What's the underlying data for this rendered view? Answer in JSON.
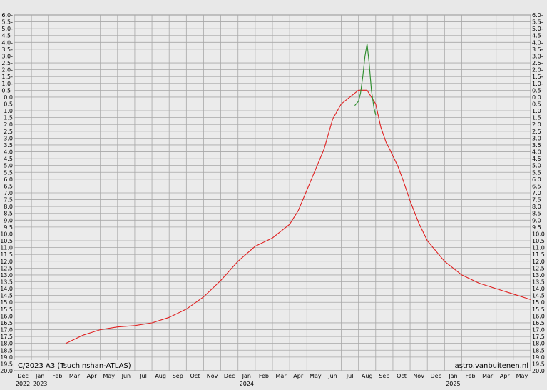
{
  "chart_data": {
    "type": "line",
    "title": "C/2023 A3 (Tsuchinshan-ATLAS)",
    "credit": "astro.vanbuitenen.nl",
    "y_tick_labels": [
      "6.0-",
      "5.5-",
      "5.0-",
      "4.5-",
      "4.0-",
      "3.5-",
      "3.0-",
      "2.5-",
      "2.0-",
      "1.5-",
      "1.0-",
      "0.5-",
      "0.0",
      "0.5",
      "1.0",
      "1.5",
      "2.0",
      "2.5",
      "3.0",
      "3.5",
      "4.0",
      "4.5",
      "5.0",
      "5.5",
      "6.0",
      "6.5",
      "7.0",
      "7.5",
      "8.0",
      "8.5",
      "9.0",
      "9.5",
      "10.0",
      "10.5",
      "11.0",
      "11.5",
      "12.0",
      "12.5",
      "13.0",
      "13.5",
      "14.0",
      "14.5",
      "15.0",
      "15.5",
      "16.0",
      "16.5",
      "17.0",
      "17.5",
      "18.0",
      "18.5",
      "19.0",
      "19.5",
      "20.0"
    ],
    "yrange": [
      -6,
      20
    ],
    "y_inverted": true,
    "x_months": [
      "Dec",
      "Jan",
      "Feb",
      "Mar",
      "Apr",
      "May",
      "Jun",
      "Jul",
      "Aug",
      "Sep",
      "Oct",
      "Nov",
      "Dec",
      "Jan",
      "Feb",
      "Mar",
      "Apr",
      "May",
      "Jun",
      "Jul",
      "Aug",
      "Sep",
      "Oct",
      "Nov",
      "Dec",
      "Jan",
      "Feb",
      "Mar",
      "Apr",
      "May"
    ],
    "x_years": [
      {
        "label": "2022",
        "month_index": 0
      },
      {
        "label": "2023",
        "month_index": 1
      },
      {
        "label": "2024",
        "month_index": 13
      },
      {
        "label": "2025",
        "month_index": 25
      }
    ],
    "grid": true,
    "series": [
      {
        "color": "#e02020",
        "x": [
          3.0,
          3.5,
          4.0,
          4.5,
          5.0,
          6.0,
          7.0,
          8.0,
          9.0,
          10.0,
          11.0,
          12.0,
          13.0,
          14.0,
          15.0,
          16.0,
          16.5,
          17.0,
          18.0,
          18.5,
          19.0,
          19.5,
          20.0,
          20.5,
          21.0,
          21.3,
          21.6,
          21.85,
          22.0,
          22.15,
          22.3,
          22.45,
          22.6,
          23.0,
          23.5,
          24.0,
          25.0,
          26.0,
          27.0,
          28.0,
          29.0,
          30.0
        ],
        "y": [
          18.0,
          17.7,
          17.4,
          17.2,
          17.0,
          16.8,
          16.7,
          16.5,
          16.1,
          15.5,
          14.6,
          13.4,
          12.0,
          10.9,
          10.3,
          9.3,
          8.3,
          6.8,
          3.8,
          1.6,
          0.5,
          0.0,
          -0.5,
          -0.5,
          0.5,
          2.2,
          3.3,
          3.9,
          4.3,
          4.7,
          5.1,
          5.6,
          6.1,
          7.6,
          9.2,
          10.5,
          12.0,
          13.0,
          13.6,
          14.0,
          14.4,
          14.8
        ]
      },
      {
        "color": "#2a8c2a",
        "x": [
          19.8,
          20.0,
          20.12,
          20.25,
          20.38,
          20.5,
          20.62,
          20.75,
          20.9,
          21.0
        ],
        "y": [
          0.6,
          0.3,
          -0.3,
          -1.5,
          -3.0,
          -3.9,
          -2.5,
          -0.5,
          0.8,
          1.3
        ]
      }
    ]
  }
}
